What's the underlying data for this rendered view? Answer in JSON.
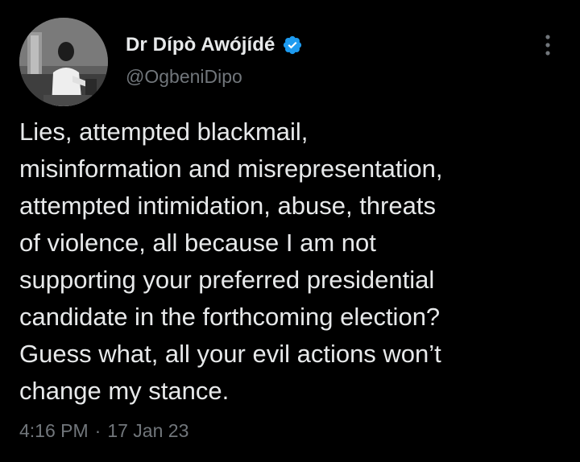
{
  "author": {
    "display_name": "Dr Dípò Awójídé",
    "handle": "@OgbeniDipo",
    "verified": true
  },
  "tweet": {
    "text": "Lies, attempted blackmail,\nmisinformation and misrepresentation,\nattempted intimidation, abuse, threats\nof violence, all because I am not\nsupporting your preferred presidential\ncandidate in the forthcoming election?\nGuess what, all your evil actions won’t\nchange my stance.",
    "time": "4:16 PM",
    "separator": "·",
    "date": "17 Jan 23"
  },
  "icons": {
    "verified": "verified-badge-icon",
    "more": "more-options-icon"
  },
  "colors": {
    "background": "#000000",
    "primary_text": "#e7e9ea",
    "secondary_text": "#71767b",
    "verified_blue": "#1d9bf0"
  }
}
